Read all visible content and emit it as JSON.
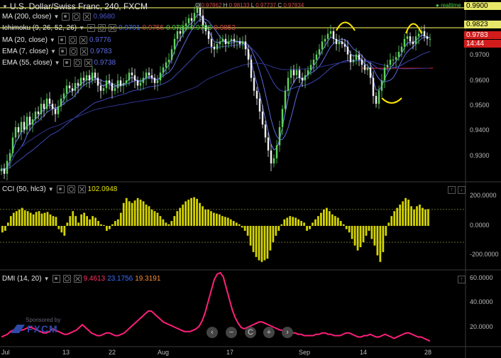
{
  "chart_data": [
    {
      "type": "line",
      "pane": "price",
      "title": "U.S. Dollar/Swiss Franc, 240, FXCM",
      "ohlc": {
        "o_label": "O",
        "o": "0.97862",
        "h_label": "H",
        "h": "0.98133",
        "l_label": "L",
        "l": "0.97737",
        "c_label": "C",
        "c": "0.97834"
      },
      "realtime_label": "realtime",
      "ylim": [
        0.924,
        0.993
      ],
      "yticks": [
        "0.9700",
        "0.9600",
        "0.9500",
        "0.9400",
        "0.9300"
      ],
      "x_labels": [
        "Jul",
        "13",
        "22",
        "Aug",
        "17",
        "Sep",
        "14",
        "28"
      ],
      "price_tags": [
        {
          "label": "0.9900",
          "value": 0.99,
          "bg": "#e7e76a",
          "fg": "#000000"
        },
        {
          "label": "0.9823",
          "value": 0.9823,
          "bg": "#e7e76a",
          "fg": "#000000"
        },
        {
          "label": "0.9783",
          "value": 0.9793,
          "bg": "#d21c1c",
          "fg": "#ffffff"
        },
        {
          "label": "14:44",
          "value": 0.9757,
          "bg": "#d21c1c",
          "fg": "#ffffff"
        }
      ],
      "horizontal_lines": [
        {
          "value": 0.99,
          "color": "#e8e85a"
        },
        {
          "value": 0.9823,
          "color": "#e8e85a"
        },
        {
          "value": 0.9667,
          "color": "#e02020",
          "x_from_label": "14",
          "partial": true
        }
      ],
      "indicators": [
        {
          "name": "MA (200, close)",
          "value": "0.9680",
          "color": "#4a55c8"
        },
        {
          "name": "Ichimoku (9, 26, 52, 26)",
          "values": [
            "0.9791",
            "0.9755",
            "0.9783",
            "0.9783",
            "0.9853"
          ],
          "colors": [
            "#3f6fff",
            "#d04848",
            "#44cc44",
            "#44cc44",
            "#d04848"
          ]
        },
        {
          "name": "MA (20, close)",
          "value": "0.9776",
          "color": "#5a6ae0"
        },
        {
          "name": "EMA (7, close)",
          "value": "0.9783",
          "color": "#5a6ae0"
        },
        {
          "name": "EMA (55, close)",
          "value": "0.9738",
          "color": "#5a6ae0"
        }
      ],
      "series": [
        {
          "name": "Close",
          "x": [
            0,
            4,
            8,
            12,
            16,
            20,
            24,
            28,
            32,
            36,
            40,
            44,
            48,
            52,
            56,
            60,
            64,
            68,
            72,
            76,
            80,
            84,
            88,
            92,
            96,
            100,
            104,
            108,
            112,
            116,
            120,
            124,
            128,
            132,
            136,
            140,
            144,
            148,
            152,
            156,
            160,
            164,
            168,
            172,
            176,
            180,
            184,
            188,
            192,
            196,
            200,
            204,
            208,
            212,
            216,
            220,
            224,
            228,
            232,
            236,
            240,
            244,
            248,
            252,
            256,
            260,
            264,
            268,
            272,
            276,
            280,
            284,
            288,
            292,
            296,
            300,
            304,
            308,
            312,
            316,
            320,
            324,
            328,
            332,
            336,
            340,
            344,
            348,
            352,
            356,
            360,
            364,
            368,
            372,
            376,
            380,
            384,
            388,
            392,
            396,
            400,
            404,
            408,
            412,
            416,
            420,
            424,
            428,
            432,
            436,
            440,
            444,
            448,
            452,
            456,
            460,
            464,
            468,
            472,
            476,
            480,
            484,
            488,
            492,
            496,
            500,
            504,
            508,
            512,
            516,
            520,
            524,
            528,
            532,
            536,
            540,
            544,
            548,
            552,
            556,
            560,
            564,
            568,
            572,
            576,
            580,
            584,
            588,
            592,
            596,
            600,
            604
          ],
          "close": [
            0.928,
            0.926,
            0.931,
            0.934,
            0.94,
            0.944,
            0.942,
            0.946,
            0.943,
            0.948,
            0.945,
            0.947,
            0.95,
            0.949,
            0.953,
            0.951,
            0.955,
            0.953,
            0.951,
            0.949,
            0.952,
            0.955,
            0.957,
            0.96,
            0.959,
            0.958,
            0.961,
            0.96,
            0.963,
            0.962,
            0.964,
            0.962,
            0.965,
            0.963,
            0.96,
            0.958,
            0.959,
            0.962,
            0.961,
            0.958,
            0.959,
            0.962,
            0.96,
            0.961,
            0.962,
            0.965,
            0.964,
            0.962,
            0.96,
            0.961,
            0.963,
            0.965,
            0.964,
            0.963,
            0.961,
            0.962,
            0.965,
            0.967,
            0.969,
            0.97,
            0.974,
            0.978,
            0.981,
            0.98,
            0.983,
            0.984,
            0.986,
            0.985,
            0.988,
            0.99,
            0.987,
            0.983,
            0.981,
            0.978,
            0.975,
            0.974,
            0.976,
            0.977,
            0.978,
            0.976,
            0.977,
            0.978,
            0.977,
            0.977,
            0.976,
            0.977,
            0.974,
            0.97,
            0.963,
            0.958,
            0.955,
            0.95,
            0.945,
            0.94,
            0.935,
            0.93,
            0.932,
            0.937,
            0.944,
            0.951,
            0.958,
            0.963,
            0.966,
            0.964,
            0.966,
            0.963,
            0.962,
            0.964,
            0.966,
            0.968,
            0.97,
            0.972,
            0.974,
            0.977,
            0.978,
            0.98,
            0.981,
            0.978,
            0.976,
            0.977,
            0.976,
            0.975,
            0.972,
            0.969,
            0.97,
            0.972,
            0.97,
            0.968,
            0.966,
            0.967,
            0.963,
            0.956,
            0.953,
            0.958,
            0.962,
            0.967,
            0.968,
            0.97,
            0.97,
            0.971,
            0.973,
            0.975,
            0.978,
            0.979,
            0.977,
            0.976,
            0.979,
            0.98,
            0.981,
            0.979,
            0.978,
            0.978
          ]
        }
      ],
      "annotations": [
        {
          "shape": "arc-top",
          "color": "#ffe600",
          "near_x_label": "Sep"
        },
        {
          "shape": "arc-bottom",
          "color": "#ffe600",
          "near_x_label": "14"
        },
        {
          "shape": "arc-top",
          "color": "#ffe600",
          "near_x_label": "28"
        }
      ]
    },
    {
      "type": "bar",
      "pane": "cci",
      "title": "CCI (50, hlc3)",
      "current": "102.0948",
      "ylim": [
        -260,
        260
      ],
      "yticks": [
        "200.0000",
        "0.0000",
        "-200.0000"
      ],
      "levels": [
        100,
        -100
      ],
      "color": "#d4d400",
      "values": [
        -40,
        -30,
        20,
        60,
        80,
        90,
        100,
        110,
        95,
        90,
        80,
        70,
        85,
        90,
        75,
        80,
        85,
        70,
        60,
        55,
        -20,
        -40,
        -60,
        20,
        60,
        90,
        60,
        20,
        70,
        80,
        60,
        40,
        60,
        50,
        30,
        10,
        5,
        -30,
        -20,
        10,
        30,
        40,
        80,
        140,
        170,
        150,
        140,
        155,
        170,
        160,
        150,
        130,
        120,
        100,
        90,
        80,
        60,
        40,
        20,
        10,
        30,
        60,
        90,
        110,
        130,
        150,
        160,
        170,
        175,
        165,
        140,
        120,
        100,
        100,
        90,
        80,
        75,
        70,
        60,
        55,
        50,
        40,
        30,
        20,
        10,
        -10,
        -30,
        -60,
        -120,
        -160,
        -190,
        -210,
        -220,
        -210,
        -200,
        -150,
        -100,
        -60,
        -30,
        10,
        40,
        50,
        60,
        55,
        50,
        40,
        30,
        20,
        -30,
        -20,
        20,
        40,
        60,
        80,
        100,
        110,
        90,
        70,
        60,
        50,
        30,
        10,
        -20,
        -40,
        -80,
        -120,
        -150,
        -130,
        -100,
        -60,
        -30,
        -80,
        -120,
        -180,
        -220,
        -160,
        -60,
        20,
        60,
        90,
        110,
        130,
        150,
        170,
        160,
        120,
        100,
        120,
        130,
        110,
        100,
        102
      ]
    },
    {
      "type": "line",
      "pane": "dmi",
      "title": "DMI (14, 20)",
      "values_label": [
        "9.4613",
        "23.1756",
        "19.3191"
      ],
      "values_colors": [
        "#ff3366",
        "#3f6fff",
        "#ff8c33"
      ],
      "ylim": [
        8,
        62
      ],
      "yticks": [
        "60.0000",
        "40.0000",
        "20.0000"
      ],
      "series": [
        {
          "name": "ADX",
          "color": "#ff1f7a",
          "values": [
            14,
            15,
            16,
            18,
            19,
            19,
            19,
            19,
            20,
            21,
            21,
            20,
            19,
            18,
            17,
            17,
            18,
            20,
            19,
            18,
            17,
            16,
            16,
            17,
            18,
            19,
            21,
            23,
            21,
            19,
            17,
            16,
            15,
            15,
            16,
            17,
            17,
            16,
            15,
            15,
            16,
            17,
            19,
            21,
            23,
            25,
            27,
            29,
            31,
            33,
            33,
            31,
            29,
            27,
            25,
            24,
            23,
            22,
            21,
            20,
            19,
            18,
            18,
            18,
            19,
            20,
            22,
            26,
            32,
            40,
            48,
            56,
            60,
            61,
            58,
            50,
            42,
            34,
            28,
            24,
            21,
            20,
            21,
            22,
            23,
            24,
            25,
            25,
            24,
            23,
            22,
            21,
            20,
            19,
            19,
            18,
            18,
            17,
            17,
            16,
            16,
            15,
            15,
            15,
            15,
            16,
            16,
            17,
            17,
            16,
            16,
            15,
            15,
            15,
            16,
            17,
            17,
            16,
            15,
            14,
            14,
            15,
            15,
            16,
            15,
            14,
            14,
            15,
            16,
            15,
            14,
            13,
            14,
            15,
            16,
            17,
            17,
            16,
            15,
            14,
            14,
            13,
            12,
            11
          ]
        }
      ]
    }
  ],
  "branding": {
    "sponsor_label": "Sponsored by",
    "brand_name": "FXCM"
  },
  "nav_controls": [
    "‹",
    "−",
    "C",
    "+",
    "›"
  ],
  "colors": {
    "background": "#000000",
    "up_candle": "#5ed35e",
    "down_candle": "#f0f0f0",
    "grid": "#262626",
    "yellow": "#e8e85a",
    "red_line": "#e02020"
  }
}
